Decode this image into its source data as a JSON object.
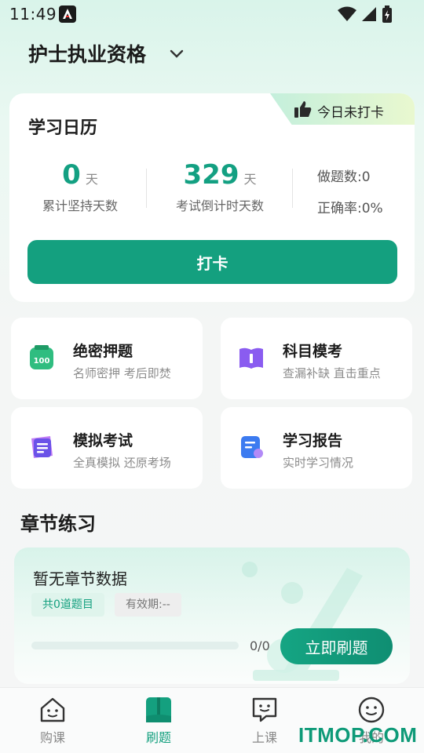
{
  "status_bar": {
    "time": "11:49"
  },
  "header": {
    "title": "护士执业资格"
  },
  "calendar": {
    "title": "学习日历",
    "badge_label": "今日未打卡",
    "streak_value": "0",
    "streak_unit": "天",
    "streak_label": "累计坚持天数",
    "countdown_value": "329",
    "countdown_unit": "天",
    "countdown_label": "考试倒计时天数",
    "questions_done": "做题数:0",
    "accuracy": "正确率:0%",
    "checkin_button": "打卡"
  },
  "tiles": [
    {
      "title": "绝密押题",
      "subtitle": "名师密押 考后即焚",
      "icon": "secret-exam-icon",
      "icon_label": "100",
      "color": "#2fbd80"
    },
    {
      "title": "科目模考",
      "subtitle": "查漏补缺 直击重点",
      "icon": "book-icon",
      "color": "#8a5cf0"
    },
    {
      "title": "模拟考试",
      "subtitle": "全真模拟 还原考场",
      "icon": "mock-exam-icon",
      "color": "#6a52e8"
    },
    {
      "title": "学习报告",
      "subtitle": "实时学习情况",
      "icon": "report-icon",
      "color": "#3c7bf0"
    }
  ],
  "chapter_practice": {
    "section_title": "章节练习",
    "card_title": "暂无章节数据",
    "tag_count": "共0道题目",
    "tag_validity": "有效期:--",
    "progress_text": "0/0",
    "progress_fraction": 0,
    "start_button": "立即刷题"
  },
  "bottom_nav": [
    {
      "label": "购课",
      "icon": "house-face-icon",
      "active": false
    },
    {
      "label": "刷题",
      "icon": "open-book-icon",
      "active": true
    },
    {
      "label": "上课",
      "icon": "chat-face-icon",
      "active": false
    },
    {
      "label": "我的",
      "icon": "smile-face-icon",
      "active": false
    }
  ],
  "watermark": "ITMOP.COM",
  "colors": {
    "accent": "#14a07f",
    "text": "#1b1b1b",
    "muted": "#8c8c8c"
  }
}
